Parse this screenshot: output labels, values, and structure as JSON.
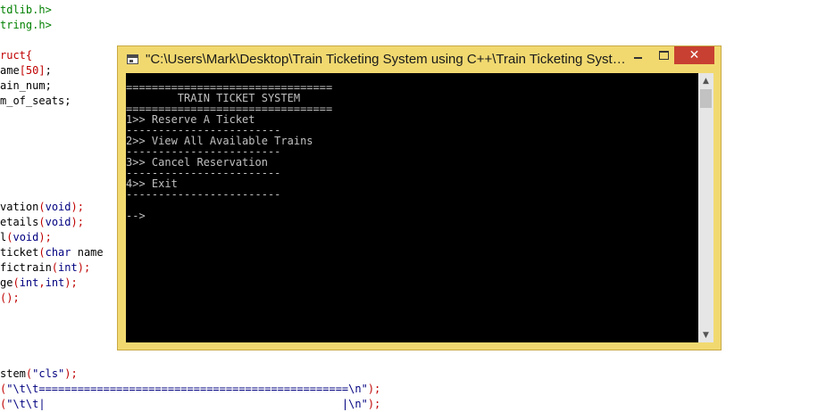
{
  "editor": {
    "lines": [
      [
        {
          "t": "tdlib.h>",
          "c": "green"
        }
      ],
      [
        {
          "t": "tring.h>",
          "c": "green"
        }
      ],
      [
        {
          "t": "ruct{",
          "c": "red"
        }
      ],
      [
        {
          "t": "ame",
          "c": "dark"
        },
        {
          "t": "[50]",
          "c": "red"
        },
        {
          "t": ";",
          "c": "dark"
        }
      ],
      [
        {
          "t": "ain_num;",
          "c": "dark"
        }
      ],
      [
        {
          "t": "m_of_seats;",
          "c": "dark"
        }
      ],
      [
        {
          "t": "vation",
          "c": "dark"
        },
        {
          "t": "(",
          "c": "red"
        },
        {
          "t": "void",
          "c": "blue"
        },
        {
          "t": ");",
          "c": "red"
        }
      ],
      [
        {
          "t": "etails",
          "c": "dark"
        },
        {
          "t": "(",
          "c": "red"
        },
        {
          "t": "void",
          "c": "blue"
        },
        {
          "t": ");",
          "c": "red"
        }
      ],
      [
        {
          "t": "l",
          "c": "dark"
        },
        {
          "t": "(",
          "c": "red"
        },
        {
          "t": "void",
          "c": "blue"
        },
        {
          "t": ");",
          "c": "red"
        }
      ],
      [
        {
          "t": "ticket",
          "c": "dark"
        },
        {
          "t": "(",
          "c": "red"
        },
        {
          "t": "char",
          "c": "blue"
        },
        {
          "t": " name",
          "c": "dark"
        }
      ],
      [
        {
          "t": "fictrain",
          "c": "dark"
        },
        {
          "t": "(",
          "c": "red"
        },
        {
          "t": "int",
          "c": "blue"
        },
        {
          "t": ");",
          "c": "red"
        }
      ],
      [
        {
          "t": "ge",
          "c": "dark"
        },
        {
          "t": "(",
          "c": "red"
        },
        {
          "t": "int",
          "c": "blue"
        },
        {
          "t": ",",
          "c": "red"
        },
        {
          "t": "int",
          "c": "blue"
        },
        {
          "t": ");",
          "c": "red"
        }
      ],
      [
        {
          "t": "();",
          "c": "red"
        }
      ],
      [
        {
          "t": "stem",
          "c": "dark"
        },
        {
          "t": "(",
          "c": "red"
        },
        {
          "t": "\"cls\"",
          "c": "blue"
        },
        {
          "t": ");",
          "c": "red"
        }
      ],
      [
        {
          "t": "(",
          "c": "red"
        },
        {
          "t": "\"\\t\\t================================================\\n\"",
          "c": "blue"
        },
        {
          "t": ");",
          "c": "red"
        }
      ],
      [
        {
          "t": "(",
          "c": "red"
        },
        {
          "t": "\"\\t\\t|                                              |\\n\"",
          "c": "blue"
        },
        {
          "t": ");",
          "c": "red"
        }
      ]
    ]
  },
  "window": {
    "title": "\"C:\\Users\\Mark\\Desktop\\Train Ticketing System using C++\\Train Ticketing Syste...",
    "close_label": "✕",
    "icon": "console-app-icon"
  },
  "console": {
    "lines": [
      "================================",
      "        TRAIN TICKET SYSTEM",
      "================================",
      "1>> Reserve A Ticket",
      "------------------------",
      "2>> View All Available Trains",
      "------------------------",
      "3>> Cancel Reservation",
      "------------------------",
      "4>> Exit",
      "------------------------",
      "",
      "-->"
    ]
  },
  "scrollbar": {
    "up_arrow": "▲",
    "down_arrow": "▼"
  },
  "colors": {
    "console_bg": "#000000",
    "console_text": "#c0c0c0",
    "frame": "#f1d970",
    "close_button": "#c84031",
    "code_green": "#008000",
    "code_red": "#c00000",
    "code_blue": "#000080"
  }
}
